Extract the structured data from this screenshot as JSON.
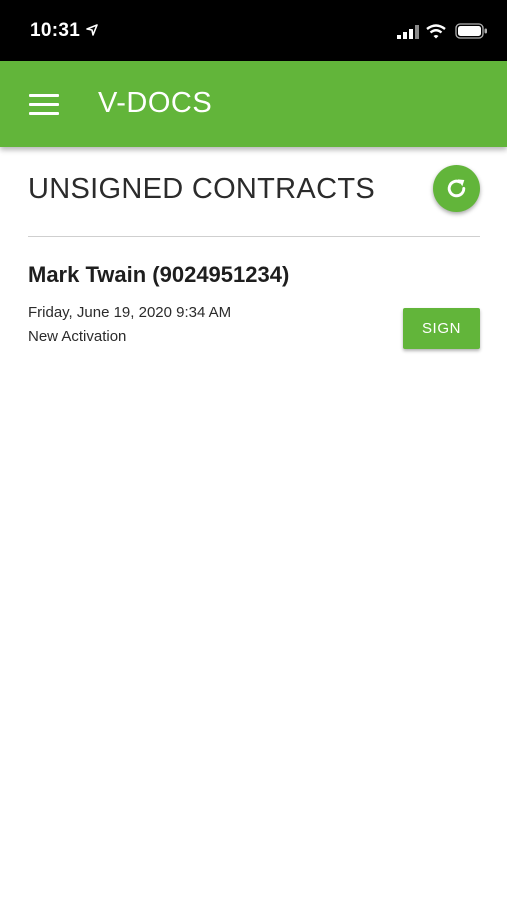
{
  "status_bar": {
    "time": "10:31",
    "icons": [
      "location-arrow-icon",
      "cellular-signal-icon",
      "wifi-icon",
      "battery-icon"
    ]
  },
  "app_bar": {
    "title": "V-DOCS",
    "menu_icon": "hamburger-menu-icon",
    "color": "#62b53a"
  },
  "main": {
    "section_title": "UNSIGNED CONTRACTS",
    "refresh_icon": "refresh-icon",
    "contracts": [
      {
        "name": "Mark Twain (9024951234)",
        "date": "Friday, June 19, 2020 9:34 AM",
        "type": "New Activation",
        "sign_label": "SIGN"
      }
    ]
  },
  "colors": {
    "accent": "#62b53a",
    "status_bar": "#000000",
    "text": "#2b2b2b"
  }
}
